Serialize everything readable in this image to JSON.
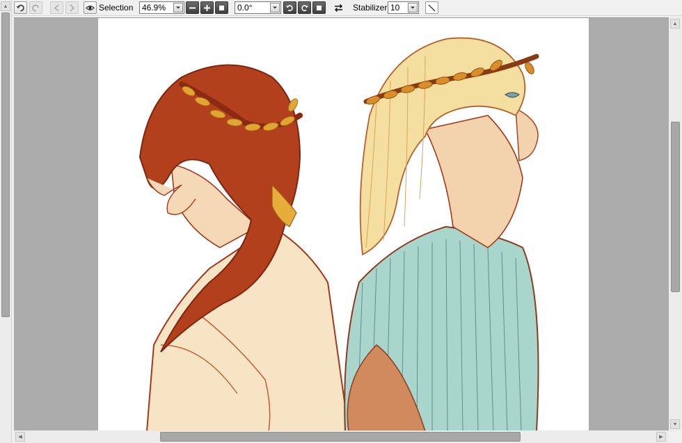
{
  "toolbar": {
    "selection_label": "Selection",
    "zoom_value": "46.9%",
    "rotation_value": "0.0°",
    "stabilizer_label": "Stabilizer",
    "stabilizer_value": "10"
  },
  "icons": {
    "undo": "undo-icon",
    "redo": "redo-icon",
    "view": "eye-icon",
    "zoom_out": "minus-icon",
    "zoom_in": "plus-icon",
    "zoom_reset": "square-icon",
    "rotate_left": "rotate-ccw-icon",
    "rotate_right": "rotate-cw-icon",
    "rotate_reset": "square-icon",
    "flip": "flip-arrows-icon",
    "line_tool": "diagonal-line-icon"
  },
  "colors": {
    "canvas_background": "#acacac",
    "page": "#ffffff",
    "hair_red": "#b3401c",
    "hair_blond": "#f4dfa0",
    "laurel_gold": "#d79a2c",
    "tunic_blue": "#a9d6cc"
  },
  "scroll": {
    "horizontal_fraction": 0.53,
    "vertical_fraction": 0.42
  }
}
